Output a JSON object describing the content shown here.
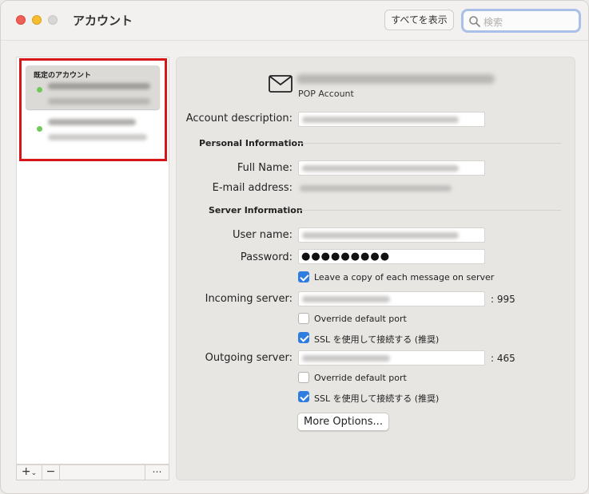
{
  "window": {
    "title": "アカウント",
    "show_all_label": "すべてを表示",
    "search_placeholder": "検索"
  },
  "sidebar": {
    "header": "既定のアカウント",
    "accounts": [
      {
        "status": "online",
        "selected": true
      },
      {
        "status": "online",
        "selected": false
      }
    ],
    "footer": {
      "add_label": "+",
      "remove_label": "−",
      "more_label": "⋯"
    }
  },
  "account": {
    "type_label": "POP Account",
    "description_label": "Account description:",
    "personal_section": "Personal Information",
    "full_name_label": "Full Name:",
    "email_label": "E-mail address:",
    "server_section": "Server Information",
    "username_label": "User name:",
    "password_label": "Password:",
    "password_value": "●●●●●●●●●",
    "leave_copy": {
      "label": "Leave a copy of each message on server",
      "checked": true
    },
    "incoming_label": "Incoming server:",
    "incoming_port": ": 995",
    "incoming_override": {
      "label": "Override default port",
      "checked": false
    },
    "incoming_ssl": {
      "label": "SSL を使用して接続する (推奨)",
      "checked": true
    },
    "outgoing_label": "Outgoing server:",
    "outgoing_port": ": 465",
    "outgoing_override": {
      "label": "Override default port",
      "checked": false
    },
    "outgoing_ssl": {
      "label": "SSL を使用して接続する (推奨)",
      "checked": true
    },
    "more_options_label": "More Options..."
  },
  "colors": {
    "accent": "#2f7de1",
    "highlight_box": "#d7161a",
    "status_online": "#6fca59"
  }
}
